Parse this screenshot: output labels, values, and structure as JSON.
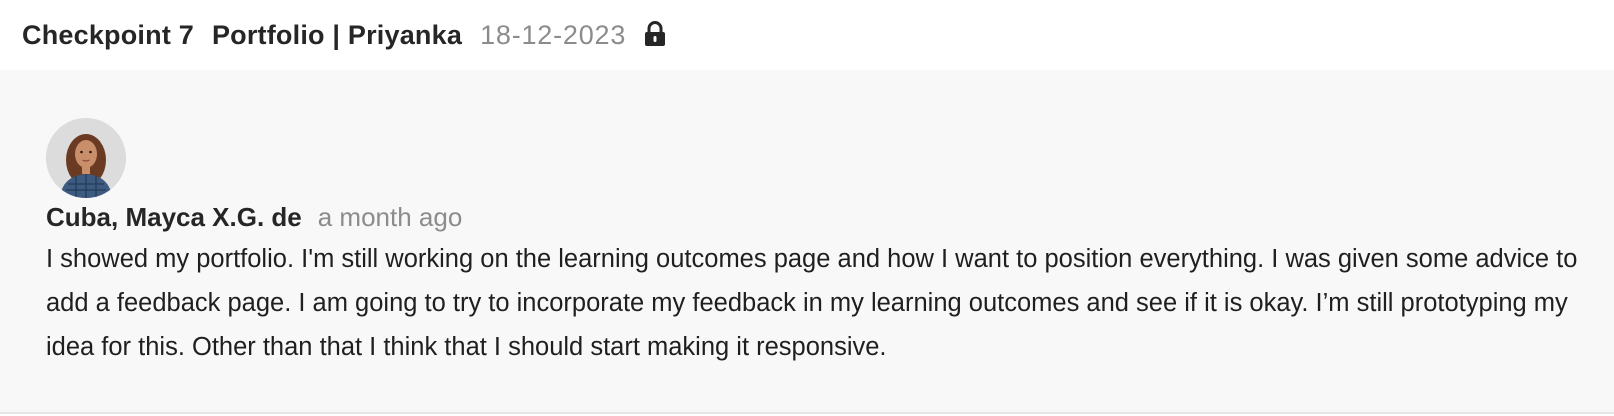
{
  "header": {
    "checkpoint": "Checkpoint 7",
    "title": "Portfolio | Priyanka",
    "date": "18-12-2023",
    "lock_icon": "lock-icon"
  },
  "feedback": {
    "avatar_icon": "user-avatar",
    "author": "Cuba, Mayca X.G. de",
    "time": "a month ago",
    "comment": "I showed my portfolio. I'm still working on the learning outcomes page and how I want to position everything. I was given some advice to add a feedback page. I am going to try to incorporate my feedback in my learning outcomes and see if it is okay. I’m still prototyping my idea for this. Other than that I think that I should start making it responsive."
  },
  "colors": {
    "header_bg": "#ffffff",
    "panel_bg": "#f8f8f8",
    "text_primary": "#262626",
    "text_muted": "#8c8c8c"
  }
}
